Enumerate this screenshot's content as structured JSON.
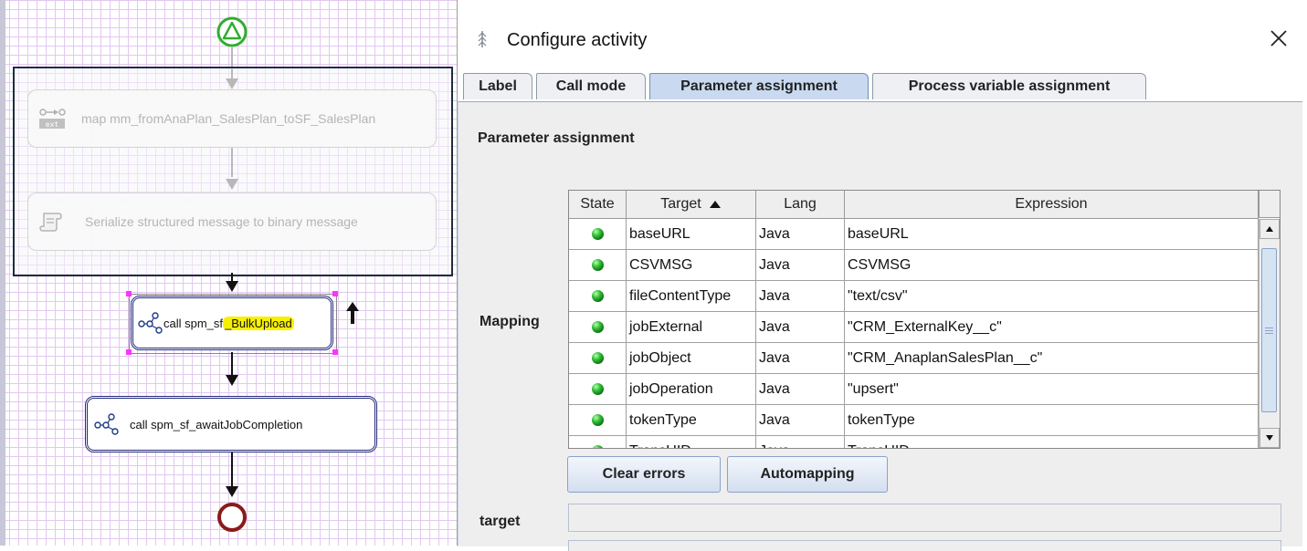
{
  "canvas": {
    "nodes": [
      {
        "label": "map mm_fromAnaPlan_SalesPlan_toSF_SalesPlan",
        "state": "disabled"
      },
      {
        "label": "Serialize structured message to binary message",
        "state": "disabled"
      },
      {
        "label_prefix": "call spm_sf",
        "label_highlight": "_BulkUpload",
        "state": "selected"
      },
      {
        "label": "call spm_sf_awaitJobCompletion",
        "state": "normal"
      }
    ]
  },
  "dialog": {
    "title": "Configure activity",
    "tabs": [
      {
        "label": "Label",
        "selected": false
      },
      {
        "label": "Call mode",
        "selected": false
      },
      {
        "label": "Parameter assignment",
        "selected": true
      },
      {
        "label": "Process variable assignment",
        "selected": false
      }
    ],
    "panel_title": "Parameter assignment",
    "mapping_label": "Mapping",
    "target_label": "target",
    "table": {
      "headers": {
        "state": "State",
        "target": "Target",
        "lang": "Lang",
        "expression": "Expression"
      },
      "sort": {
        "column": "Target",
        "direction": "ascending"
      },
      "rows": [
        {
          "target": "baseURL",
          "lang": "Java",
          "expression": "baseURL"
        },
        {
          "target": "CSVMSG",
          "lang": "Java",
          "expression": "CSVMSG"
        },
        {
          "target": "fileContentType",
          "lang": "Java",
          "expression": "\"text/csv\""
        },
        {
          "target": "jobExternal",
          "lang": "Java",
          "expression": "\"CRM_ExternalKey__c\""
        },
        {
          "target": "jobObject",
          "lang": "Java",
          "expression": "\"CRM_AnaplanSalesPlan__c\""
        },
        {
          "target": "jobOperation",
          "lang": "Java",
          "expression": "\"upsert\""
        },
        {
          "target": "tokenType",
          "lang": "Java",
          "expression": "tokenType"
        },
        {
          "target": "TransUID",
          "lang": "Java",
          "expression": "TransUID"
        }
      ]
    },
    "buttons": {
      "clear_errors": "Clear errors",
      "automapping": "Automapping"
    },
    "colors": {
      "selected_tab": "#c9daf0",
      "status_ok": "#35c23a",
      "highlight": "#f7f000"
    }
  }
}
